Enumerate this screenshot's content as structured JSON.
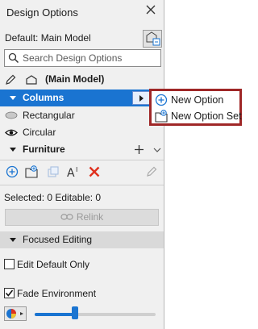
{
  "panel": {
    "title": "Design Options",
    "default_label": "Default: Main Model",
    "search": {
      "placeholder": "Search Design Options"
    },
    "main_model": {
      "label": "(Main Model)"
    },
    "sets": [
      {
        "label": "Columns",
        "selected": true,
        "options": [
          {
            "label": "Rectangular",
            "icon": "eye-closed-icon"
          },
          {
            "label": "Circular",
            "icon": "eye-open-icon"
          }
        ]
      },
      {
        "label": "Furniture",
        "selected": false,
        "options": []
      }
    ],
    "status": "Selected: 0 Editable: 0",
    "relink_label": "Relink",
    "focused_editing": {
      "title": "Focused Editing",
      "edit_default_only": {
        "label": "Edit Default Only",
        "checked": false
      },
      "fade_environment": {
        "label": "Fade Environment",
        "checked": true
      }
    },
    "fade_level": 0.33
  },
  "popup": {
    "items": [
      {
        "label": "New Option",
        "icon": "new-option-icon"
      },
      {
        "label": "New Option Set",
        "icon": "new-option-set-icon"
      }
    ]
  },
  "colors": {
    "accent": "#1a74d1",
    "highlight_border": "#9f2727",
    "delete": "#e0301e"
  }
}
